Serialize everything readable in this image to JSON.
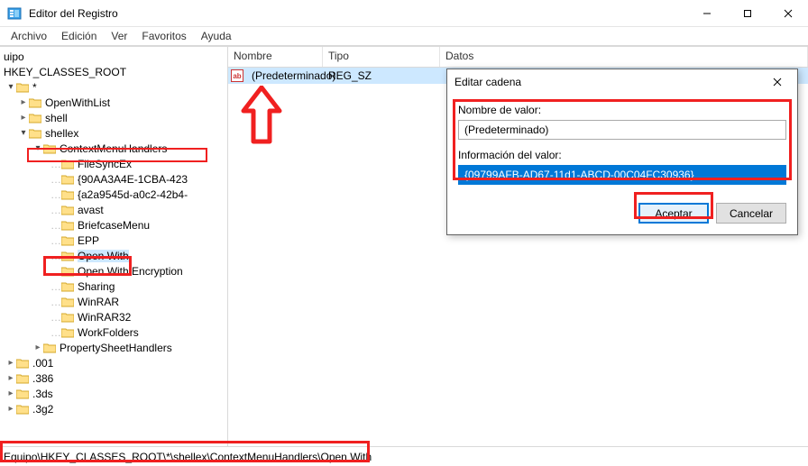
{
  "window": {
    "title": "Editor del Registro",
    "btn_min": "—",
    "btn_max": "☐",
    "btn_close": "✕"
  },
  "menu": {
    "file": "Archivo",
    "edit": "Edición",
    "view": "Ver",
    "favorites": "Favoritos",
    "help": "Ayuda"
  },
  "columns": {
    "name": "Nombre",
    "type": "Tipo",
    "data": "Datos"
  },
  "row": {
    "name": "(Predeterminado)",
    "type": "REG_SZ",
    "data": ""
  },
  "tree": {
    "root_top": "uipo",
    "root": "HKEY_CLASSES_ROOT",
    "star": "*",
    "openwithlist": "OpenWithList",
    "shell": "shell",
    "shellex": "shellex",
    "cmh": "ContextMenuHandlers",
    "items": [
      "FileSyncEx",
      "{90AA3A4E-1CBA-423",
      "{a2a9545d-a0c2-42b4-",
      "avast",
      "BriefcaseMenu",
      "EPP",
      "Open With",
      "Open With Encryption",
      "Sharing",
      "WinRAR",
      "WinRAR32",
      "WorkFolders"
    ],
    "psh": "PropertySheetHandlers",
    "tail": [
      ".001",
      ".386",
      ".3ds",
      ".3g2"
    ]
  },
  "status": {
    "path": "Equipo\\HKEY_CLASSES_ROOT\\*\\shellex\\ContextMenuHandlers\\Open With"
  },
  "dialog": {
    "title": "Editar cadena",
    "close": "✕",
    "name_label": "Nombre de valor:",
    "name_value": "(Predeterminado)",
    "data_label": "Información del valor:",
    "data_value": "{09799AFB-AD67-11d1-ABCD-00C04FC30936}",
    "ok": "Aceptar",
    "cancel": "Cancelar"
  },
  "colors": {
    "annotation": "#f02020",
    "selection": "#cde8ff",
    "accent": "#0078d7"
  }
}
